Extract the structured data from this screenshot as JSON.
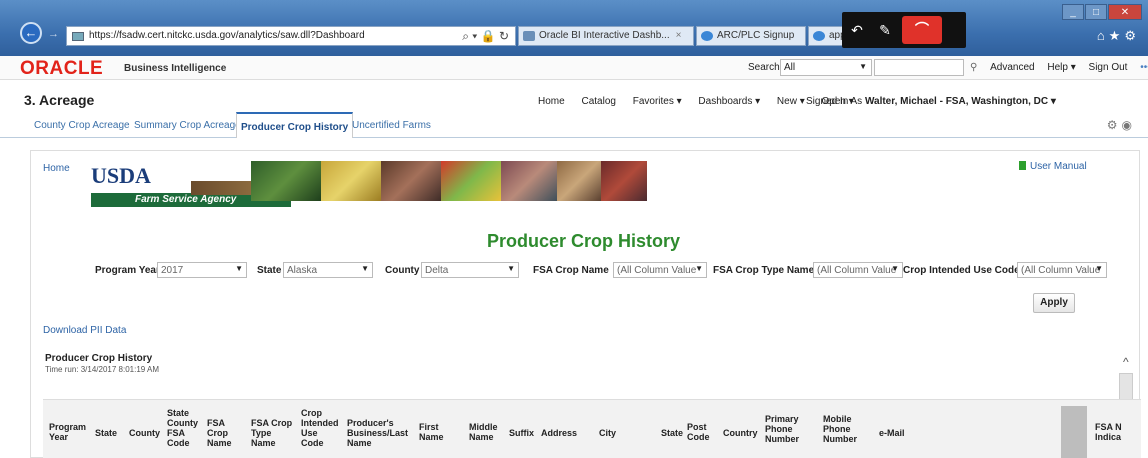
{
  "browser": {
    "url": "https://fsadw.cert.nitckc.usda.gov/analytics/saw.dll?Dashboard",
    "address_tools": "⌕ ▾ 🔒 ↻",
    "tabs": [
      {
        "label": "Oracle BI Interactive Dashb...",
        "close": "×"
      },
      {
        "label": "ARC/PLC Signup"
      },
      {
        "label": "app"
      }
    ]
  },
  "oracle_header": {
    "logo": "ORACLE",
    "product": "Business Intelligence",
    "search_label": "Search",
    "search_scope": "All",
    "links": [
      "Advanced",
      "Help ▾",
      "Sign Out"
    ]
  },
  "dashboard": {
    "title": "3. Acreage",
    "menu": [
      "Home",
      "Catalog",
      "Favorites ▾",
      "Dashboards ▾",
      "New ▾",
      "Open ▾"
    ],
    "signed_in_label": "Signed In As",
    "signed_in_user": "Walter, Michael - FSA, Washington, DC ▾",
    "tabs": [
      "County Crop Acreage",
      "Summary Crop Acreage",
      "Producer Crop History",
      "Uncertified Farms"
    ]
  },
  "content": {
    "home_link": "Home",
    "usda": "USDA",
    "agency": "Farm Service Agency",
    "user_manual": "User Manual",
    "heading": "Producer Crop History",
    "prompts": [
      {
        "label": "Program Year",
        "value": "2017"
      },
      {
        "label": "State",
        "value": "Alaska"
      },
      {
        "label": "County",
        "value": "Delta"
      },
      {
        "label": "FSA Crop Name",
        "value": "(All Column Value"
      },
      {
        "label": "FSA Crop Type Name",
        "value": "(All Column Value"
      },
      {
        "label": "Crop Intended Use Code",
        "value": "(All Column Value"
      }
    ],
    "apply": "Apply",
    "download": "Download PII Data",
    "report_title": "Producer Crop History",
    "time_run": "Time run: 3/14/2017 8:01:19 AM"
  },
  "table": {
    "columns": [
      "Program Year",
      "State",
      "County",
      "State County FSA Code",
      "FSA Crop Name",
      "FSA Crop Type Name",
      "Crop Intended Use Code",
      "Producer's Business/Last Name",
      "First Name",
      "Middle Name",
      "Suffix",
      "Address",
      "City",
      "State",
      "Post Code",
      "Country",
      "Primary Phone Number",
      "Mobile Phone Number",
      "e-Mail",
      "FSA N Indica"
    ]
  }
}
